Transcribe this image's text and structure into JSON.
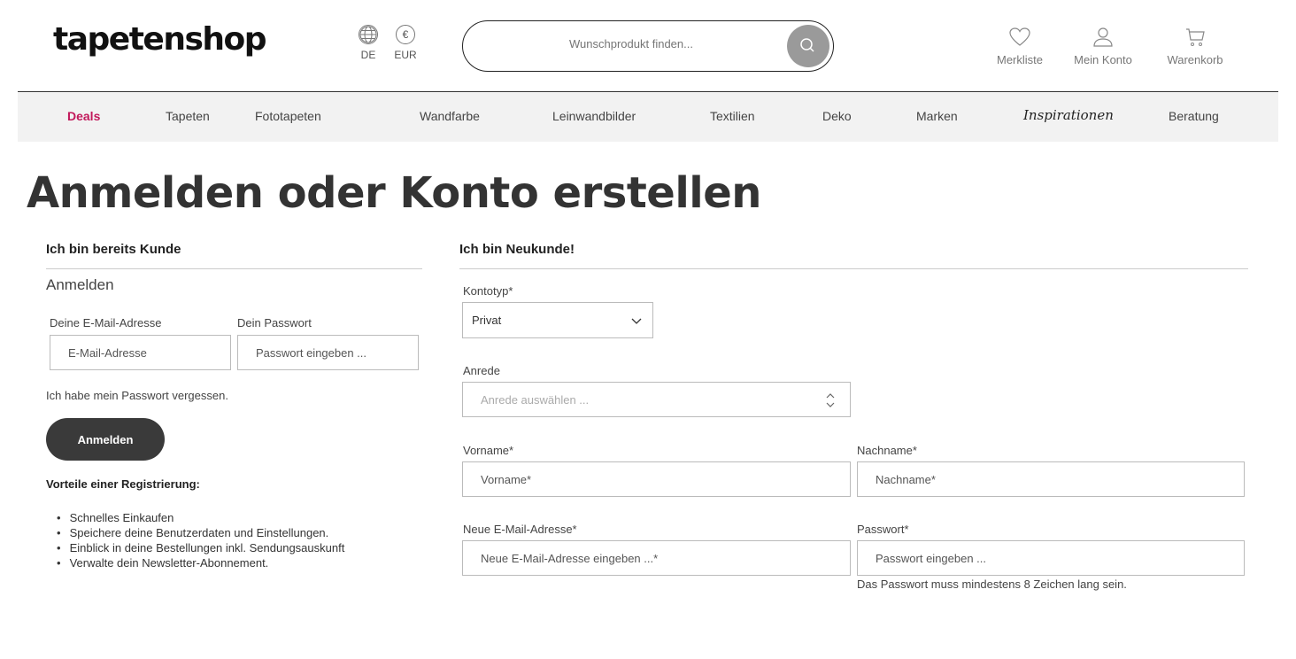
{
  "header": {
    "logo": "tapetenshop",
    "language": "DE",
    "currency": "EUR",
    "currency_symbol": "€",
    "search_placeholder": "Wunschprodukt finden...",
    "wishlist": "Merkliste",
    "account": "Mein Konto",
    "cart": "Warenkorb"
  },
  "nav": {
    "items": [
      "Deals",
      "Tapeten",
      "Fototapeten",
      "Wandfarbe",
      "Leinwandbilder",
      "Textilien",
      "Deko",
      "Marken",
      "Inspirationen",
      "Beratung"
    ]
  },
  "colors": {
    "accent": "#c2185b",
    "button_dark": "#3a3a3a",
    "nav_bg": "#f2f2f2"
  },
  "page": {
    "title": "Anmelden oder Konto erstellen"
  },
  "login": {
    "heading": "Ich bin bereits Kunde",
    "subheading": "Anmelden",
    "email_label": "Deine E-Mail-Adresse",
    "email_placeholder": "E-Mail-Adresse",
    "password_label": "Dein Passwort",
    "password_placeholder": "Passwort eingeben ...",
    "forgot": "Ich habe mein Passwort vergessen.",
    "submit": "Anmelden",
    "benefits_heading": "Vorteile einer Registrierung:",
    "benefits": [
      "Schnelles Einkaufen",
      "Speichere deine Benutzerdaten und Einstellungen.",
      "Einblick in deine Bestellungen inkl. Sendungsauskunft",
      "Verwalte dein Newsletter-Abonnement."
    ]
  },
  "register": {
    "heading": "Ich bin Neukunde!",
    "account_type_label": "Kontotyp*",
    "account_type_value": "Privat",
    "salutation_label": "Anrede",
    "salutation_placeholder": "Anrede auswählen ...",
    "firstname_label": "Vorname*",
    "firstname_placeholder": "Vorname*",
    "lastname_label": "Nachname*",
    "lastname_placeholder": "Nachname*",
    "email_label": "Neue E-Mail-Adresse*",
    "email_placeholder": "Neue E-Mail-Adresse eingeben ...*",
    "password_label": "Passwort*",
    "password_placeholder": "Passwort eingeben ...",
    "password_hint": "Das Passwort muss mindestens 8 Zeichen lang sein."
  }
}
